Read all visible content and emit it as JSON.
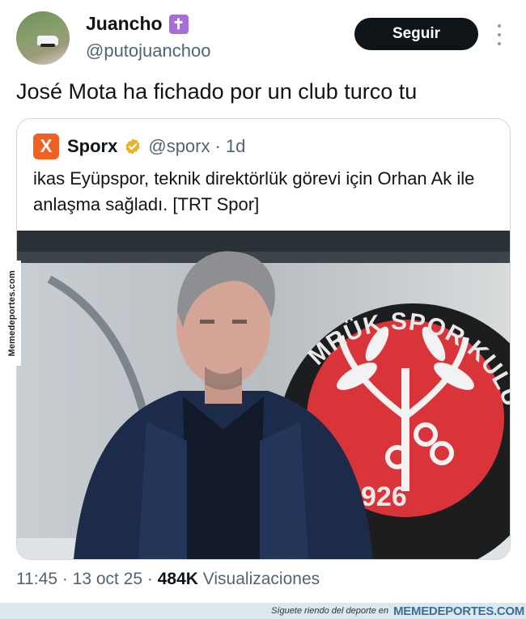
{
  "tweet": {
    "author_name": "Juancho",
    "author_badge": "✝",
    "author_handle": "@putojuanchoo",
    "follow_label": "Seguir",
    "text": "José Mota ha fichado por un club turco tu",
    "timestamp": "11:45 · 13 oct 25 · ",
    "views_count": "484K",
    "views_label": " Visualizaciones"
  },
  "quoted_tweet": {
    "logo_letter": "X",
    "author_name": "Sporx",
    "verified_icon": "verified-badge-gold",
    "author_handle": "@sporx",
    "separator": "·",
    "time": "1d",
    "text": "ikas Eyüpspor, teknik direktörlük görevi için Orhan Ak ile anlaşma sağladı. [TRT Spor]",
    "image": {
      "description_icon": "photo",
      "badge_top_text": "MRÜK SPOR KULÜBÜ",
      "badge_year": "926"
    }
  },
  "watermark": {
    "side_text": "Memedeportes.com",
    "footer_tagline": "Síguete riendo del deporte en",
    "footer_brand": "MEMEDEPORTES.COM"
  },
  "colors": {
    "follow_bg": "#0f1419",
    "sporx_orange": "#f06224",
    "verified_gold": "#e8b229",
    "secondary_text": "#536471",
    "badge_red": "#d8343a"
  }
}
